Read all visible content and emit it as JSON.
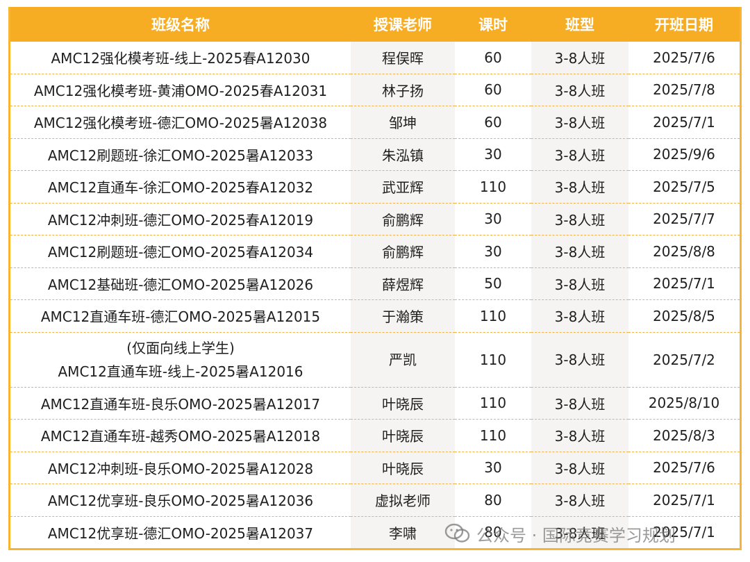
{
  "headers": [
    "班级名称",
    "授课老师",
    "课时",
    "班型",
    "开班日期"
  ],
  "rows": [
    {
      "name": "AMC12强化模考班-线上-2025春A12030",
      "note": "",
      "teacher": "程俣晖",
      "hours": "60",
      "type": "3-8人班",
      "date": "2025/7/6"
    },
    {
      "name": "AMC12强化模考班-黄浦OMO-2025春A12031",
      "note": "",
      "teacher": "林子扬",
      "hours": "60",
      "type": "3-8人班",
      "date": "2025/7/8"
    },
    {
      "name": "AMC12强化模考班-德汇OMO-2025暑A12038",
      "note": "",
      "teacher": "邹坤",
      "hours": "60",
      "type": "3-8人班",
      "date": "2025/7/1"
    },
    {
      "name": "AMC12刷题班-徐汇OMO-2025暑A12033",
      "note": "",
      "teacher": "朱泓镇",
      "hours": "30",
      "type": "3-8人班",
      "date": "2025/9/6"
    },
    {
      "name": "AMC12直通车-徐汇OMO-2025春A12032",
      "note": "",
      "teacher": "武亚辉",
      "hours": "110",
      "type": "3-8人班",
      "date": "2025/7/5"
    },
    {
      "name": "AMC12冲刺班-德汇OMO-2025春A12019",
      "note": "",
      "teacher": "俞鹏辉",
      "hours": "30",
      "type": "3-8人班",
      "date": "2025/7/7"
    },
    {
      "name": "AMC12刷题班-德汇OMO-2025春A12034",
      "note": "",
      "teacher": "俞鹏辉",
      "hours": "30",
      "type": "3-8人班",
      "date": "2025/8/8"
    },
    {
      "name": "AMC12基础班-德汇OMO-2025暑A12026",
      "note": "",
      "teacher": "薛煜辉",
      "hours": "50",
      "type": "3-8人班",
      "date": "2025/7/1"
    },
    {
      "name": "AMC12直通车班-德汇OMO-2025暑A12015",
      "note": "",
      "teacher": "于瀚策",
      "hours": "110",
      "type": "3-8人班",
      "date": "2025/8/5"
    },
    {
      "name": "AMC12直通车班-线上-2025暑A12016",
      "note": "(仅面向线上学生)",
      "teacher": "严凯",
      "hours": "110",
      "type": "3-8人班",
      "date": "2025/7/2"
    },
    {
      "name": "AMC12直通车班-良乐OMO-2025暑A12017",
      "note": "",
      "teacher": "叶晓辰",
      "hours": "110",
      "type": "3-8人班",
      "date": "2025/8/10"
    },
    {
      "name": "AMC12直通车班-越秀OMO-2025暑A12018",
      "note": "",
      "teacher": "叶晓辰",
      "hours": "110",
      "type": "3-8人班",
      "date": "2025/8/3"
    },
    {
      "name": "AMC12冲刺班-良乐OMO-2025暑A12028",
      "note": "",
      "teacher": "叶晓辰",
      "hours": "30",
      "type": "3-8人班",
      "date": "2025/7/6"
    },
    {
      "name": "AMC12优享班-良乐OMO-2025暑A12036",
      "note": "",
      "teacher": "虚拟老师",
      "hours": "80",
      "type": "3-8人班",
      "date": "2025/7/1"
    },
    {
      "name": "AMC12优享班-德汇OMO-2025暑A12037",
      "note": "",
      "teacher": "李啸",
      "hours": "80",
      "type": "3-8人班",
      "date": "2025/7/1"
    }
  ],
  "watermark": {
    "text": "公众号 · 国际竞赛学习规划",
    "icon": "wechat-icon"
  },
  "colors": {
    "header_bg": "#f6ad24",
    "header_text": "#ffffff",
    "border": "#f7b531",
    "alt_col": "#f5f4f2"
  }
}
